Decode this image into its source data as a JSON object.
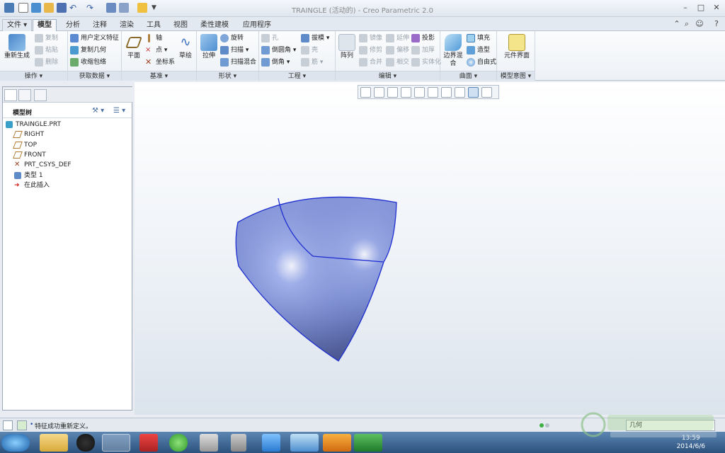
{
  "window": {
    "title": "TRAINGLE (活动的) - Creo Parametric 2.0"
  },
  "ribbon": {
    "tabs": [
      "文件",
      "模型",
      "分析",
      "注释",
      "渲染",
      "工具",
      "视图",
      "柔性建模",
      "应用程序"
    ],
    "active_tab": "模型",
    "groups": {
      "operations": {
        "label": "操作",
        "regenerate": "重新生成",
        "copy": "复制",
        "paste": "粘贴",
        "delete": "删除"
      },
      "get_data": {
        "label": "获取数据",
        "udf": "用户定义特征",
        "copy_geom": "复制几何",
        "shrinkwrap": "收缩包络"
      },
      "datum": {
        "label": "基准",
        "plane": "平面",
        "axis": "轴",
        "point": "点",
        "csys": "坐标系",
        "sketch": "草绘"
      },
      "shapes": {
        "label": "形状",
        "extrude": "拉伸",
        "revolve": "旋转",
        "sweep": "扫描",
        "swept_blend": "扫描混合"
      },
      "engineering": {
        "label": "工程",
        "hole": "孔",
        "round": "倒圆角",
        "chamfer": "倒角",
        "draft": "拔模",
        "shell": "壳",
        "rib": "筋"
      },
      "editing": {
        "label": "编辑",
        "pattern": "阵列",
        "mirror": "镜像",
        "trim": "修剪",
        "merge": "合并",
        "extend": "延伸",
        "offset": "偏移",
        "intersect": "相交",
        "project": "投影",
        "thicken": "加厚",
        "solidify": "实体化"
      },
      "surfaces": {
        "label": "曲面",
        "boundary_blend": "边界混合",
        "fill": "填充",
        "style": "造型",
        "freestyle": "自由式"
      },
      "model_intent": {
        "label": "模型意图",
        "component_interface": "元件界面"
      }
    }
  },
  "model_tree": {
    "header": "模型树",
    "items": [
      {
        "label": "TRAINGLE.PRT",
        "icon": "part-icon"
      },
      {
        "label": "RIGHT",
        "icon": "datum-plane-icon"
      },
      {
        "label": "TOP",
        "icon": "datum-plane-icon"
      },
      {
        "label": "FRONT",
        "icon": "datum-plane-icon"
      },
      {
        "label": "PRT_CSYS_DEF",
        "icon": "csys-icon"
      },
      {
        "label": "类型 1",
        "icon": "boundary-blend-icon"
      },
      {
        "label": "在此插入",
        "icon": "insert-here-arrow-icon"
      }
    ]
  },
  "status": {
    "message": "特征成功重新定义。",
    "filter": "几何"
  },
  "taskbar": {
    "time": "13:59",
    "date": "2014/6/6"
  },
  "colors": {
    "surface_fill": "#7d8fd4",
    "surface_edge": "#1f2fd0",
    "ribbon_bg": "#edf1f6",
    "taskbar": "#3a6291"
  }
}
